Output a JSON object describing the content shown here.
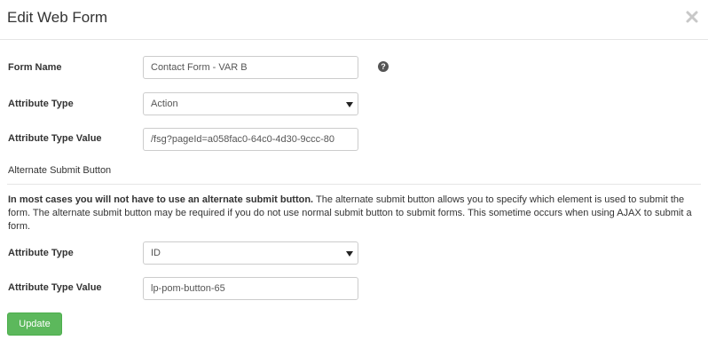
{
  "dialog": {
    "title": "Edit Web Form"
  },
  "form": {
    "form_name_label": "Form Name",
    "form_name_value": "Contact Form - VAR B",
    "attribute_type_label": "Attribute Type",
    "attribute_type_value": "Action",
    "attribute_type_value_label": "Attribute Type Value",
    "attribute_type_value_value": "/fsg?pageId=a058fac0-64c0-4d30-9ccc-80"
  },
  "alternate_submit": {
    "section_label": "Alternate Submit Button",
    "note_bold": "In most cases you will not have to use an alternate submit button.",
    "note_text": " The alternate submit button allows you to specify which element is used to submit the form. The alternate submit button may be required if you do not use normal submit button to submit forms. This sometime occurs when using AJAX to submit a form.",
    "attribute_type_label": "Attribute Type",
    "attribute_type_value": "ID",
    "attribute_type_value_label": "Attribute Type Value",
    "attribute_type_value_value": "lp-pom-button-65"
  },
  "actions": {
    "update_label": "Update"
  },
  "colors": {
    "update_button": "#5cb85c"
  },
  "icons": {
    "close": "close-icon",
    "help": "question-circle-icon",
    "dropdown": "caret-down-icon"
  }
}
